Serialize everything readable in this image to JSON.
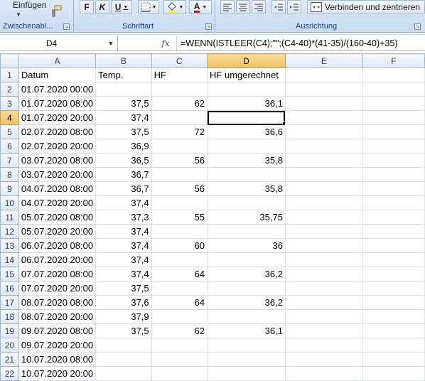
{
  "ribbon": {
    "clipboard": {
      "paste_label": "Einfügen",
      "group_label": "Zwischenabl..."
    },
    "font": {
      "bold_label": "F",
      "italic_label": "K",
      "underline_label": "U",
      "group_label": "Schriftart"
    },
    "alignment": {
      "merge_label": "Verbinden und zentrieren",
      "group_label": "Ausrichtung"
    }
  },
  "formula_bar": {
    "name_box": "D4",
    "fx_label": "fx",
    "formula": "=WENN(ISTLEER(C4);\"\";(C4-40)*(41-35)/(160-40)+35)"
  },
  "columns": [
    "A",
    "B",
    "C",
    "D",
    "E",
    "F"
  ],
  "active_cell": {
    "row": 4,
    "column": "D"
  },
  "rows": [
    {
      "n": "1",
      "a": "Datum",
      "b": "Temp.",
      "c": "HF",
      "d": "HF umgerechnet"
    },
    {
      "n": "2",
      "a": "01.07.2020 00:00",
      "b": "",
      "c": "",
      "d": ""
    },
    {
      "n": "3",
      "a": "01.07.2020 08:00",
      "b": "37,5",
      "c": "62",
      "d": "36,1"
    },
    {
      "n": "4",
      "a": "01.07.2020 20:00",
      "b": "37,4",
      "c": "",
      "d": ""
    },
    {
      "n": "5",
      "a": "02.07.2020 08:00",
      "b": "37,5",
      "c": "72",
      "d": "36,6"
    },
    {
      "n": "6",
      "a": "02.07.2020 20:00",
      "b": "36,9",
      "c": "",
      "d": ""
    },
    {
      "n": "7",
      "a": "03.07.2020 08:00",
      "b": "36,5",
      "c": "56",
      "d": "35,8"
    },
    {
      "n": "8",
      "a": "03.07.2020 20:00",
      "b": "36,7",
      "c": "",
      "d": ""
    },
    {
      "n": "9",
      "a": "04.07.2020 08:00",
      "b": "36,7",
      "c": "56",
      "d": "35,8"
    },
    {
      "n": "10",
      "a": "04.07.2020 20:00",
      "b": "37,4",
      "c": "",
      "d": ""
    },
    {
      "n": "11",
      "a": "05.07.2020 08:00",
      "b": "37,3",
      "c": "55",
      "d": "35,75"
    },
    {
      "n": "12",
      "a": "05.07.2020 20:00",
      "b": "37,4",
      "c": "",
      "d": ""
    },
    {
      "n": "13",
      "a": "06.07.2020 08:00",
      "b": "37,4",
      "c": "60",
      "d": "36"
    },
    {
      "n": "14",
      "a": "06.07.2020 20:00",
      "b": "37,4",
      "c": "",
      "d": ""
    },
    {
      "n": "15",
      "a": "07.07.2020 08:00",
      "b": "37,4",
      "c": "64",
      "d": "36,2"
    },
    {
      "n": "16",
      "a": "07.07.2020 20:00",
      "b": "37,5",
      "c": "",
      "d": ""
    },
    {
      "n": "17",
      "a": "08.07.2020 08:00",
      "b": "37,6",
      "c": "64",
      "d": "36,2"
    },
    {
      "n": "18",
      "a": "08.07.2020 20:00",
      "b": "37,9",
      "c": "",
      "d": ""
    },
    {
      "n": "19",
      "a": "09.07.2020 08:00",
      "b": "37,5",
      "c": "62",
      "d": "36,1"
    },
    {
      "n": "20",
      "a": "09.07.2020 20:00",
      "b": "",
      "c": "",
      "d": ""
    },
    {
      "n": "21",
      "a": "10.07.2020 08:00",
      "b": "",
      "c": "",
      "d": ""
    },
    {
      "n": "22",
      "a": "10.07.2020 20:00",
      "b": "",
      "c": "",
      "d": ""
    }
  ]
}
